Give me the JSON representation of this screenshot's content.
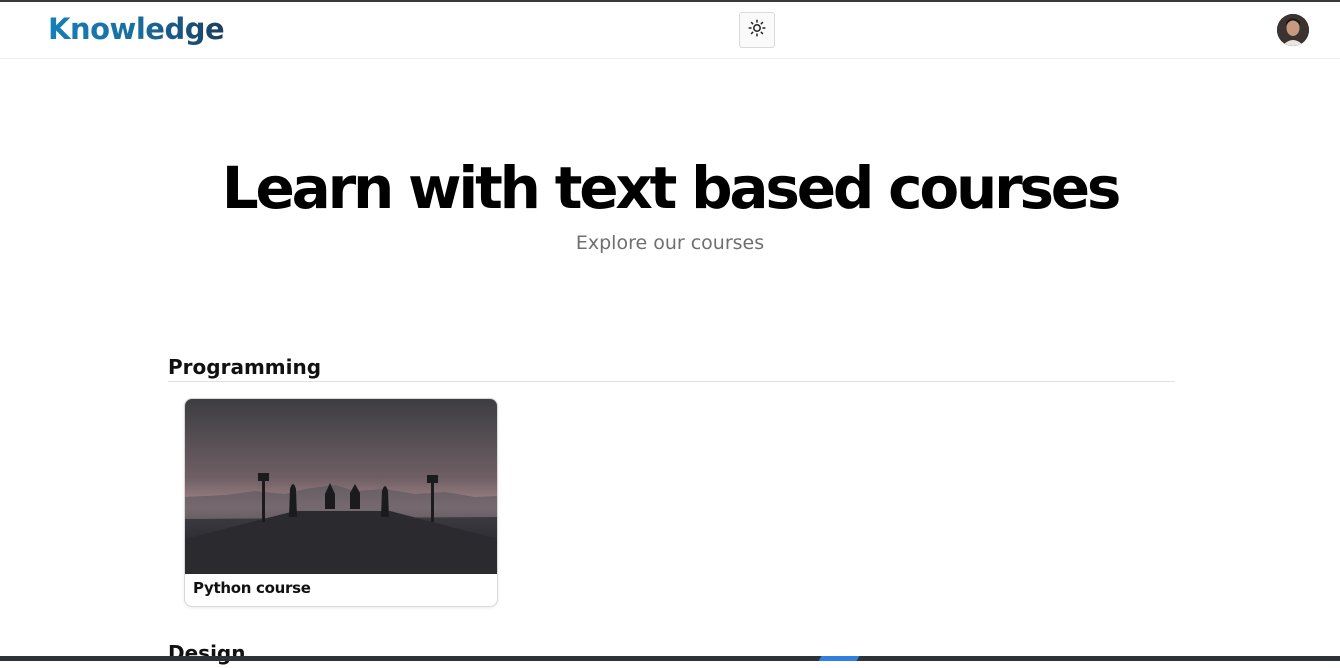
{
  "header": {
    "logo": "Knowledge",
    "theme_toggle_icon": "sun-icon",
    "avatar_icon": "user-avatar"
  },
  "hero": {
    "title": "Learn with text based courses",
    "subtitle": "Explore our courses"
  },
  "sections": [
    {
      "title": "Programming",
      "courses": [
        {
          "title": "Python course"
        }
      ]
    },
    {
      "title": "Design"
    }
  ],
  "colors": {
    "logo_gradient": [
      "#1580b8",
      "#1b3f5e"
    ],
    "bottom_accent": "#2f7fe0"
  }
}
